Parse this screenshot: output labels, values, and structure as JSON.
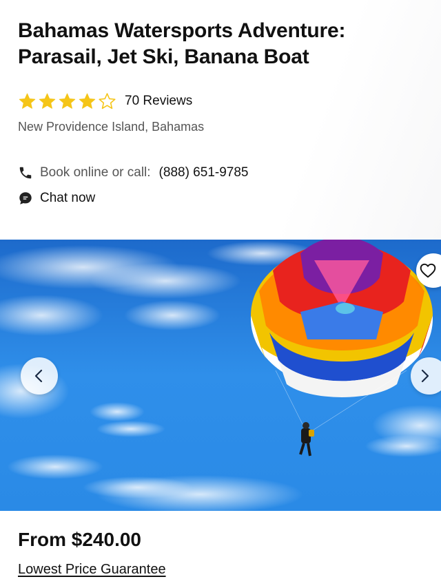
{
  "header": {
    "title_line1": "Bahamas Watersports Adventure:",
    "title_line2": "Parasail, Jet Ski, Banana Boat",
    "rating": {
      "value": 4,
      "max": 5,
      "reviews_label": "70 Reviews"
    },
    "location": "New Providence Island, Bahamas",
    "contact": {
      "book_label": "Book online or call:",
      "phone": "(888) 651-9785",
      "chat_label": "Chat now"
    }
  },
  "gallery": {
    "icons": {
      "prev": "chevron-left-icon",
      "next": "chevron-right-icon",
      "favorite": "heart-outline-icon"
    }
  },
  "offer": {
    "price_label": "From $240.00",
    "guarantee_label": "Lowest Price Guarantee"
  },
  "colors": {
    "star": "#f5c518",
    "sky": "#2a86e6",
    "text_primary": "#111111",
    "text_secondary": "#555555"
  }
}
